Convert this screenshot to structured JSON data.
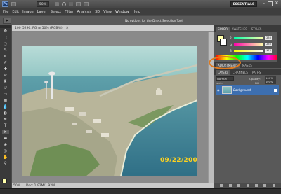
{
  "app": {
    "logo": "Ps",
    "workspace": "ESSENTIALS",
    "zoom": "50%"
  },
  "menu": [
    "File",
    "Edit",
    "Image",
    "Layer",
    "Select",
    "Filter",
    "Analysis",
    "3D",
    "View",
    "Window",
    "Help"
  ],
  "options_bar": {
    "hint": "No options for the Direct Selection Tool."
  },
  "document": {
    "tab_title": "100_5296.JPG @ 50% (RGB/8)",
    "date_stamp": "09/22/2009",
    "status_zoom": "50%",
    "status_doc": "Doc: 1.92M/1.92M"
  },
  "color_panel": {
    "tabs": [
      "COLOR",
      "SWATCHES",
      "STYLES"
    ],
    "channels": [
      {
        "label": "R",
        "value": "255"
      },
      {
        "label": "G",
        "value": "255"
      },
      {
        "label": "B",
        "value": "170"
      }
    ]
  },
  "adjust_panel": {
    "tabs": [
      "ADJUSTMENTS",
      "MASKS"
    ]
  },
  "layers_panel": {
    "tabs": [
      "LAYERS",
      "CHANNELS",
      "PATHS"
    ],
    "blend_mode": "Normal",
    "opacity_label": "Opacity:",
    "opacity_value": "100%",
    "lock_label": "Lock:",
    "fill_label": "Fill:",
    "fill_value": "100%",
    "layer_name": "Background"
  },
  "colors": {
    "accent": "#3d6fb0",
    "highlight_ring": "#e07a1e",
    "date_stamp": "#ffd21e"
  }
}
